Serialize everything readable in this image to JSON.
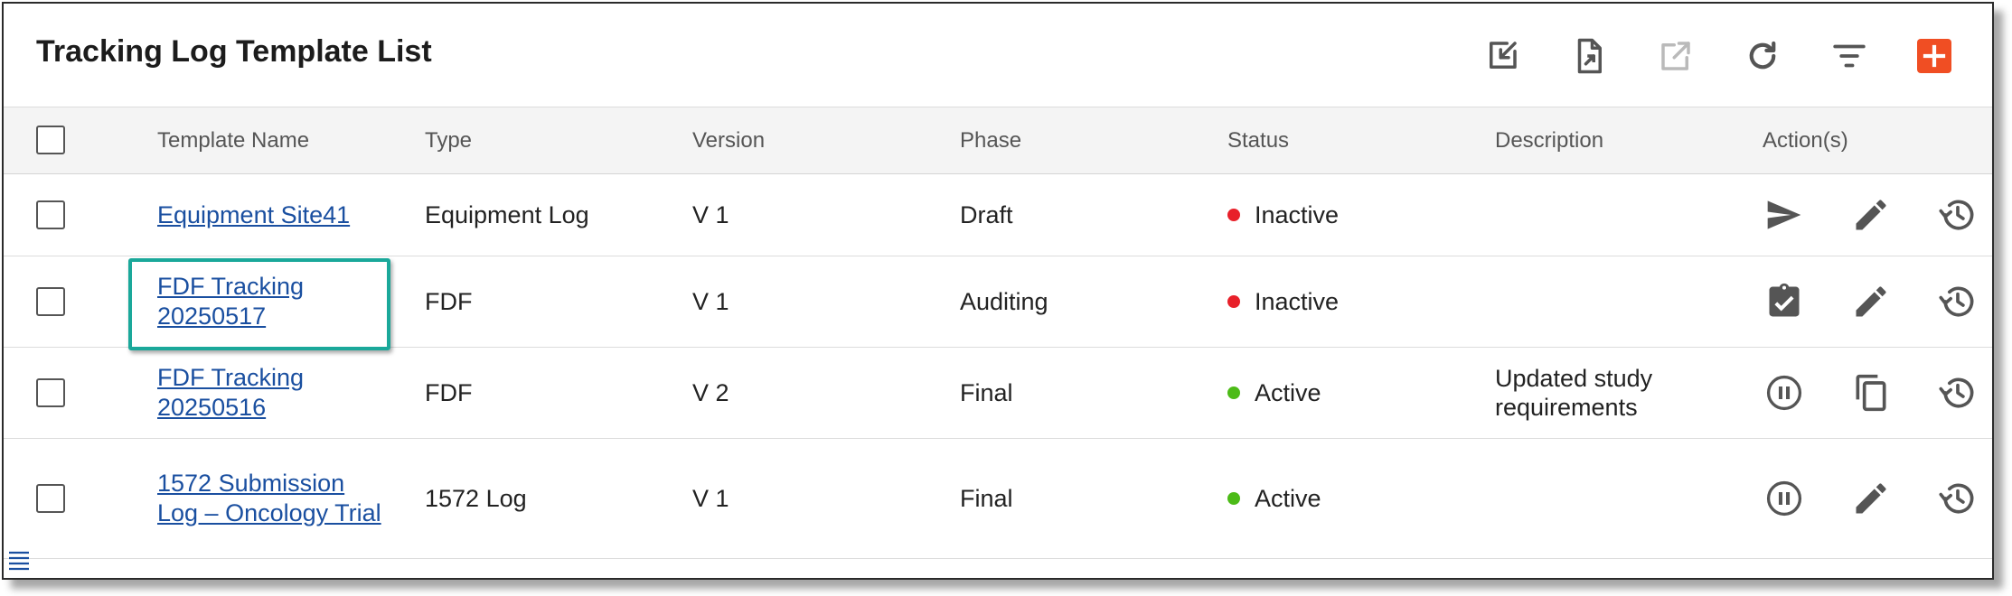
{
  "title": "Tracking Log Template List",
  "colors": {
    "accent": "#f04e23",
    "link": "#1a4fa0",
    "inactive": "#e8202a",
    "active": "#4cbb17",
    "highlight": "#1aa89a",
    "icon": "#555555"
  },
  "toolbar": {
    "icons": [
      "import-icon",
      "export-file-icon",
      "open-external-icon",
      "refresh-icon",
      "filter-icon",
      "add-icon"
    ]
  },
  "columns": [
    "Template Name",
    "Type",
    "Version",
    "Phase",
    "Status",
    "Description",
    "Action(s)"
  ],
  "rows": [
    {
      "name": "Equipment Site41",
      "type": "Equipment Log",
      "version": "V 1",
      "phase": "Draft",
      "status": "Inactive",
      "description": "",
      "actions": [
        "send-icon",
        "edit-icon",
        "history-icon"
      ]
    },
    {
      "name": "FDF Tracking 20250517",
      "type": "FDF",
      "version": "V 1",
      "phase": "Auditing",
      "status": "Inactive",
      "description": "",
      "actions": [
        "clipboard-check-icon",
        "edit-icon",
        "history-icon"
      ]
    },
    {
      "name": "FDF Tracking 20250516",
      "type": "FDF",
      "version": "V 2",
      "phase": "Final",
      "status": "Active",
      "description": "Updated study requirements",
      "actions": [
        "pause-icon",
        "copy-icon",
        "history-icon"
      ]
    },
    {
      "name": "1572 Submission Log – Oncology Trial",
      "type": "1572 Log",
      "version": "V 1",
      "phase": "Final",
      "status": "Active",
      "description": "",
      "actions": [
        "pause-icon",
        "edit-icon",
        "history-icon"
      ]
    }
  ]
}
